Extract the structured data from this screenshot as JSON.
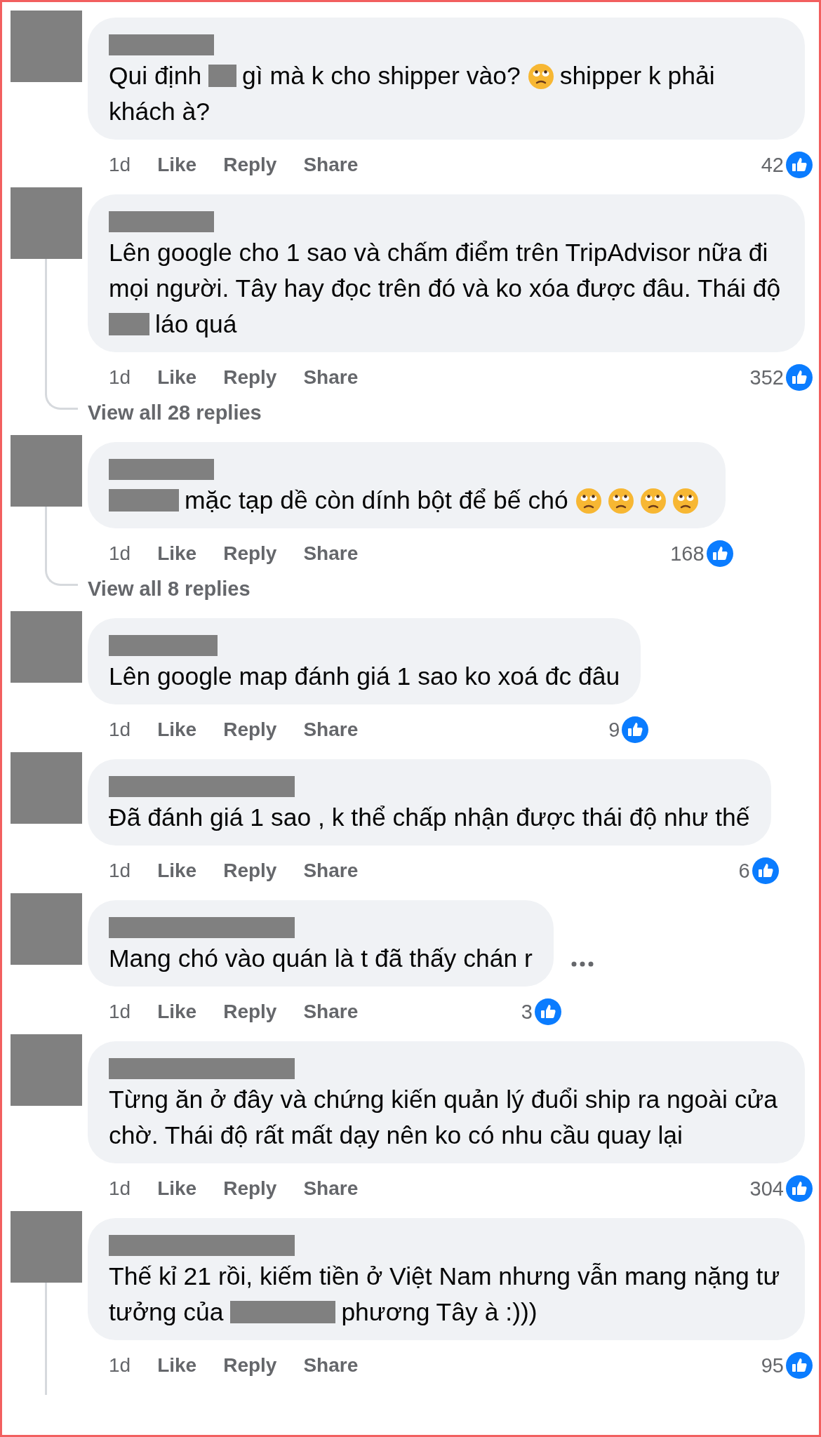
{
  "comments": [
    {
      "body": [
        {
          "kind": "text",
          "text": "Qui định"
        },
        {
          "kind": "redacted"
        },
        {
          "kind": "text",
          "text": "gì mà k cho shipper vào?"
        },
        {
          "kind": "emoji"
        },
        {
          "kind": "text",
          "text": "shipper k phải khách à?"
        }
      ],
      "time": "1d",
      "actions": [
        "Like",
        "Reply",
        "Share"
      ],
      "likes": "42",
      "more_button": false,
      "thread_line": false
    },
    {
      "body": [
        {
          "kind": "text",
          "text": "Lên google cho 1 sao và chấm điểm trên TripAdvisor nữa đi mọi người. Tây hay đọc trên đó và ko xóa được đâu. Thái độ"
        },
        {
          "kind": "redacted"
        },
        {
          "kind": "text",
          "text": "láo quá"
        }
      ],
      "time": "1d",
      "actions": [
        "Like",
        "Reply",
        "Share"
      ],
      "likes": "352",
      "more_button": false,
      "thread_line": true,
      "view_replies": "View all 28 replies"
    },
    {
      "body": [
        {
          "kind": "redacted"
        },
        {
          "kind": "text",
          "text": "mặc tạp dề còn dính bột để bế chó"
        },
        {
          "kind": "emoji"
        },
        {
          "kind": "emoji"
        },
        {
          "kind": "emoji"
        },
        {
          "kind": "emoji"
        }
      ],
      "time": "1d",
      "actions": [
        "Like",
        "Reply",
        "Share"
      ],
      "likes": "168",
      "more_button": false,
      "thread_line": true,
      "view_replies": "View all 8 replies"
    },
    {
      "body": [
        {
          "kind": "text",
          "text": "Lên google map đánh giá 1 sao ko xoá đc đâu"
        }
      ],
      "time": "1d",
      "actions": [
        "Like",
        "Reply",
        "Share"
      ],
      "likes": "9",
      "more_button": false,
      "thread_line": false
    },
    {
      "body": [
        {
          "kind": "text",
          "text": "Đã đánh giá 1 sao , k thể chấp nhận được thái độ như thế"
        }
      ],
      "time": "1d",
      "actions": [
        "Like",
        "Reply",
        "Share"
      ],
      "likes": "6",
      "more_button": false,
      "thread_line": false
    },
    {
      "body": [
        {
          "kind": "text",
          "text": "Mang chó vào quán là t đã thấy chán r"
        }
      ],
      "time": "1d",
      "actions": [
        "Like",
        "Reply",
        "Share"
      ],
      "likes": "3",
      "more_button": true,
      "thread_line": false
    },
    {
      "body": [
        {
          "kind": "text",
          "text": "Từng ăn ở đây và chứng kiến quản lý đuổi ship ra ngoài cửa chờ. Thái độ rất mất dạy nên ko có nhu cầu quay lại"
        }
      ],
      "time": "1d",
      "actions": [
        "Like",
        "Reply",
        "Share"
      ],
      "likes": "304",
      "more_button": false,
      "thread_line": false
    },
    {
      "body": [
        {
          "kind": "text",
          "text": "Thế kỉ 21 rồi, kiếm tiền ở Việt Nam nhưng vẫn mang nặng tư tưởng của"
        },
        {
          "kind": "redacted"
        },
        {
          "kind": "text",
          "text": "phương Tây à :)))"
        }
      ],
      "time": "1d",
      "actions": [
        "Like",
        "Reply",
        "Share"
      ],
      "likes": "95",
      "more_button": false,
      "thread_line": true
    }
  ]
}
